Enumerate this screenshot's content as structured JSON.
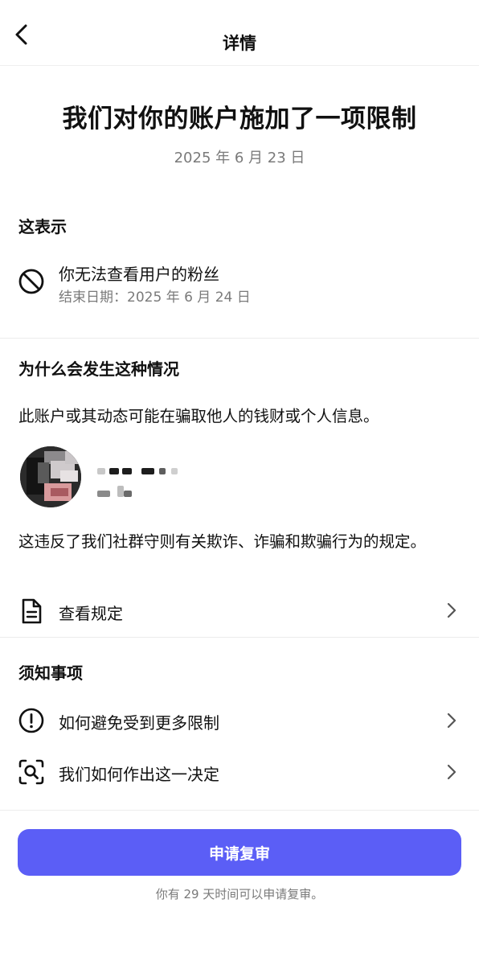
{
  "header": {
    "title": "详情"
  },
  "headline": "我们对你的账户施加了一项限制",
  "date": "2025 年 6 月 23 日",
  "meaning": {
    "title": "这表示",
    "item_label": "你无法查看用户的粉丝",
    "item_sub": "结束日期：2025 年 6 月 24 日"
  },
  "why": {
    "title": "为什么会发生这种情况",
    "reason": "此账户或其动态可能在骗取他人的钱财或个人信息。",
    "violation": "这违反了我们社群守则有关欺诈、诈骗和欺骗行为的规定。",
    "guideline_link": "查看规定"
  },
  "notes": {
    "title": "须知事项",
    "items": [
      {
        "label": "如何避免受到更多限制",
        "icon": "exclamation-circle-icon"
      },
      {
        "label": "我们如何作出这一决定",
        "icon": "scan-search-icon"
      }
    ]
  },
  "footer": {
    "button_label": "申请复审",
    "note": "你有 29 天时间可以申请复审。"
  },
  "colors": {
    "accent": "#5b5ef6",
    "muted": "#7a7a7a",
    "divider": "#ececec"
  }
}
